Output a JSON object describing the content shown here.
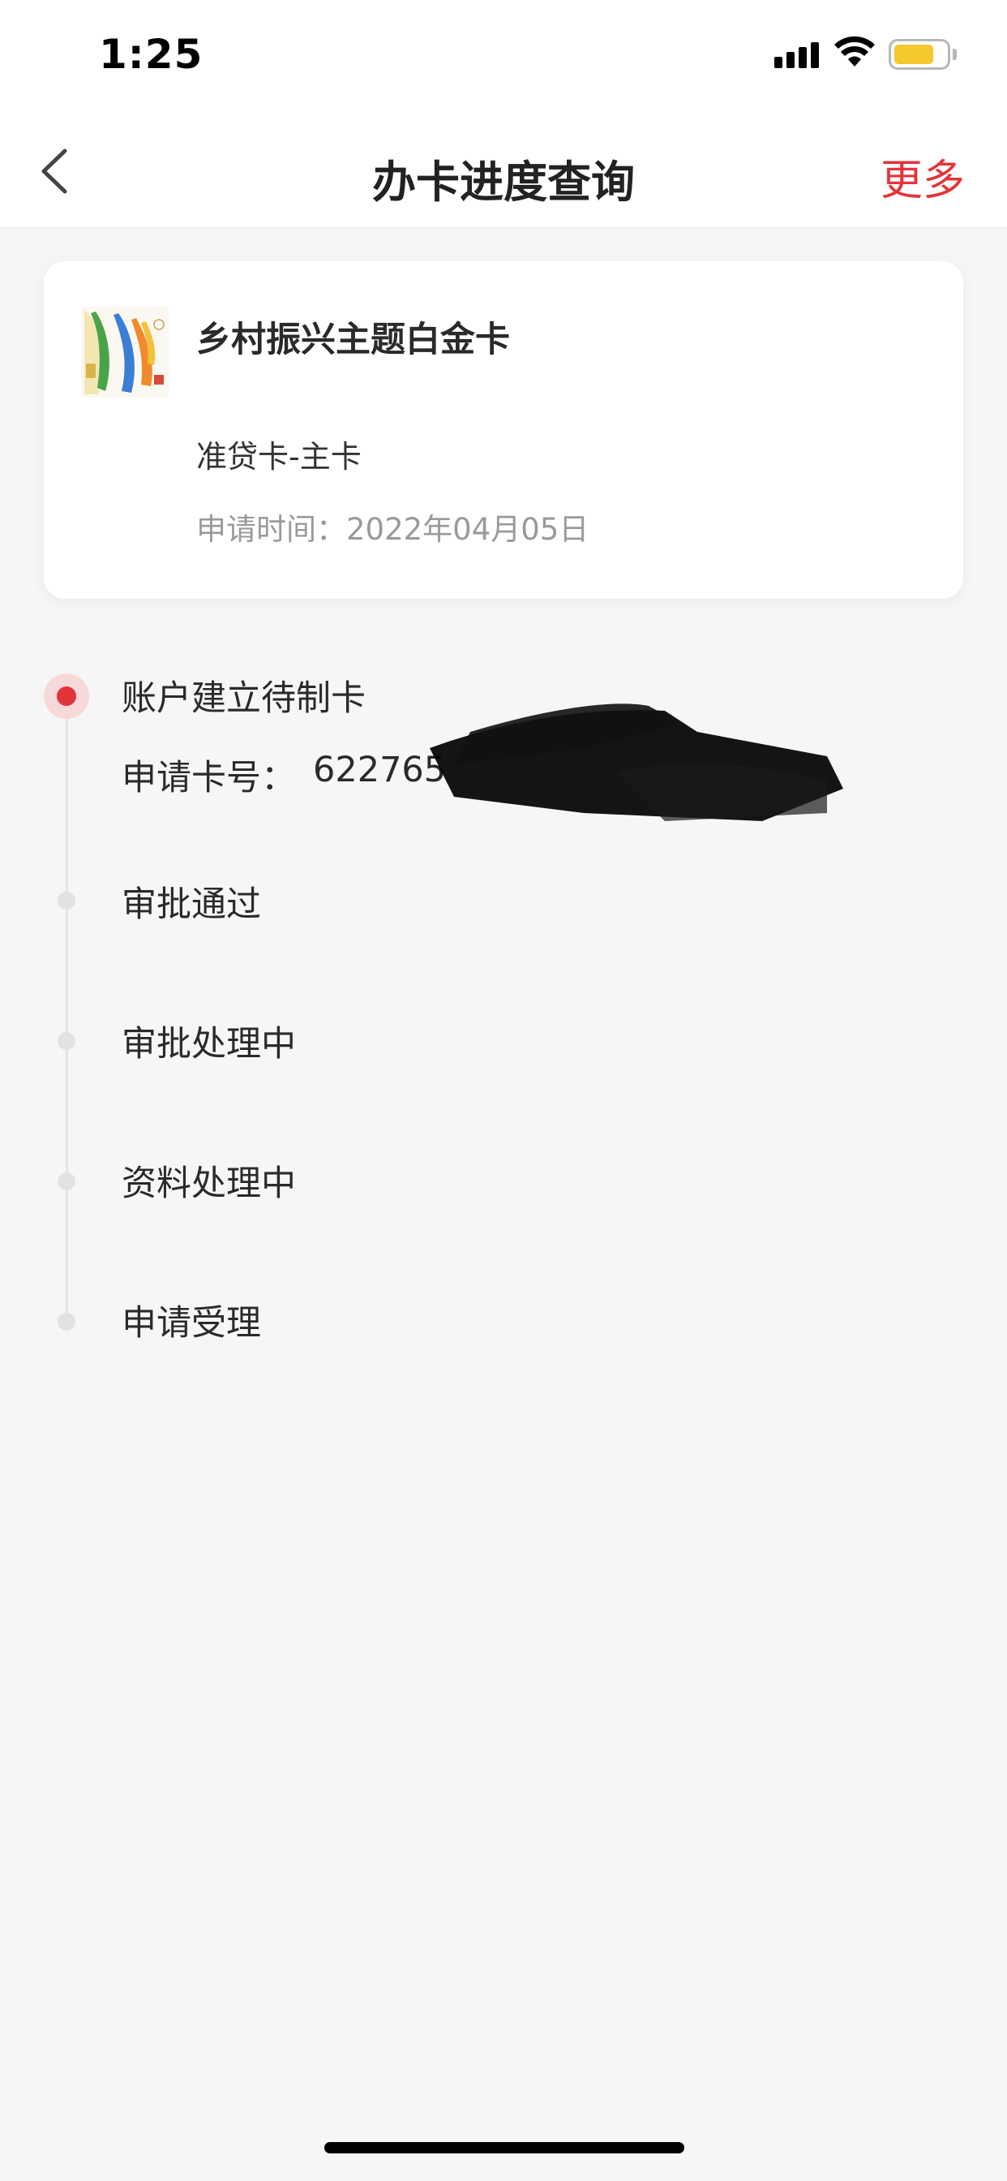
{
  "status_bar": {
    "time": "1:25"
  },
  "nav": {
    "title": "办卡进度查询",
    "more_label": "更多"
  },
  "card": {
    "name": "乡村振兴主题白金卡",
    "type": "准贷卡-主卡",
    "apply_time": "申请时间：2022年04月05日"
  },
  "timeline": {
    "current_step": "账户建立待制卡",
    "card_no_label": "申请卡号：",
    "card_no_visible": "622765",
    "steps": [
      "审批通过",
      "审批处理中",
      "资料处理中",
      "申请受理"
    ]
  },
  "colors": {
    "accent": "#e2353a",
    "battery": "#f5c82e",
    "inactive_dot": "#e2e2e2"
  }
}
